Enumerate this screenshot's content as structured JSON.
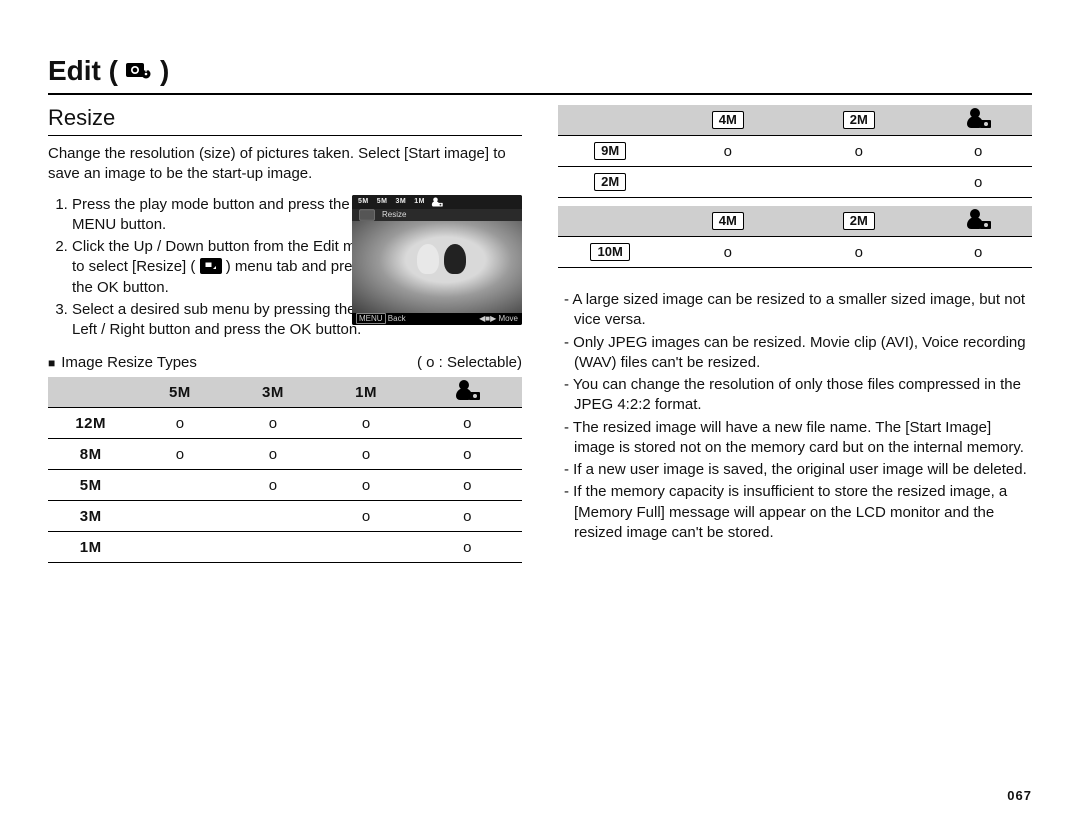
{
  "title": {
    "prefix": "Edit (",
    "suffix": " )"
  },
  "section": "Resize",
  "intro": "Change the resolution (size) of pictures taken. Select [Start image] to save an image to be the start-up image.",
  "steps": [
    "Press the play mode button and press the MENU button.",
    "Click the Up / Down button from the Edit menu to select [Resize] (        ) menu tab and press the OK button.",
    "Select a desired sub menu by pressing the Left / Right button and press the OK button."
  ],
  "screenshot": {
    "top": [
      "5M",
      "5M",
      "3M",
      "1M"
    ],
    "label": "Resize",
    "back": "Back",
    "move": "Move",
    "menu": "MENU"
  },
  "legend": {
    "label": "Image Resize Types",
    "note": "( o : Selectable)"
  },
  "mark": "o",
  "table1": {
    "cols": [
      "5M",
      "3M",
      "1M",
      "user"
    ],
    "rows": [
      {
        "label": "12M",
        "cells": [
          "o",
          "o",
          "o",
          "o"
        ]
      },
      {
        "label": "8M",
        "cells": [
          "o",
          "o",
          "o",
          "o"
        ]
      },
      {
        "label": "5M",
        "cells": [
          "",
          "o",
          "o",
          "o"
        ]
      },
      {
        "label": "3M",
        "cells": [
          "",
          "",
          "o",
          "o"
        ]
      },
      {
        "label": "1M",
        "cells": [
          "",
          "",
          "",
          "o"
        ]
      }
    ]
  },
  "table2": {
    "cols": [
      "4M",
      "2M",
      "user"
    ],
    "rows": [
      {
        "label": "9M",
        "cells": [
          "o",
          "o",
          "o"
        ]
      },
      {
        "label": "2M",
        "cells": [
          "",
          "",
          "o"
        ]
      }
    ]
  },
  "table3": {
    "cols": [
      "4M",
      "2M",
      "user"
    ],
    "wide": true,
    "rows": [
      {
        "label": "10M",
        "cells": [
          "o",
          "o",
          "o"
        ]
      }
    ]
  },
  "notes": [
    "A large sized image can be resized to a smaller sized image, but not vice versa.",
    "Only JPEG images can be resized. Movie clip (AVI), Voice recording (WAV) files can't be resized.",
    "You can change the resolution of only those files compressed in the JPEG 4:2:2 format.",
    "The resized image will have a new file name. The [Start Image] image is stored not on the memory card but on the internal memory.",
    "If a new user image is saved, the original user image will be deleted.",
    "If the memory capacity is insufficient to store the resized image, a [Memory Full] message will appear on the LCD monitor and the resized image can't be stored."
  ],
  "page_num": "067"
}
